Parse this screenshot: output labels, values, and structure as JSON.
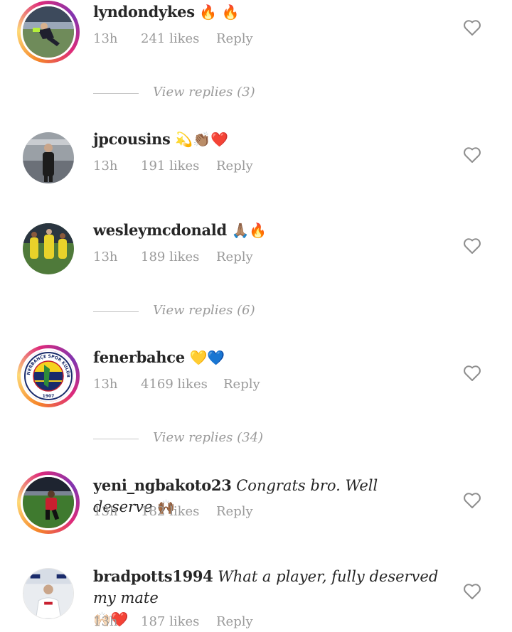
{
  "comments": [
    {
      "username": "lyndondykes",
      "text": "",
      "emoji": "🔥 🔥",
      "time": "13h",
      "likes": "241 likes",
      "reply": "Reply",
      "avatar": "football player photo",
      "ring": true,
      "replies": "View replies (3)"
    },
    {
      "username": "jpcousins",
      "text": "",
      "emoji": "💫👏🏽❤️",
      "time": "13h",
      "likes": "191 likes",
      "reply": "Reply",
      "avatar": "man standing in stadium photo",
      "ring": false,
      "replies": ""
    },
    {
      "username": "wesleymcdonald",
      "text": "",
      "emoji": "🙏🏽🔥",
      "time": "13h",
      "likes": "189 likes",
      "reply": "Reply",
      "avatar": "players in yellow kits photo",
      "ring": false,
      "replies": "View replies (6)"
    },
    {
      "username": "fenerbahce",
      "text": "",
      "emoji": "💛💙",
      "time": "13h",
      "likes": "4169 likes",
      "reply": "Reply",
      "avatar": "Fenerbahçe Spor Kulübü crest",
      "ring": true,
      "replies": "View replies (34)"
    },
    {
      "username": "yeni_ngbakoto23",
      "text": "Congrats bro. Well deserve",
      "emoji": "🙌🏾",
      "time": "13h",
      "likes": "182 likes",
      "reply": "Reply",
      "avatar": "football player on pitch photo",
      "ring": true,
      "replies": ""
    },
    {
      "username": "bradpotts1994",
      "text": "What a player, fully deserved my mate",
      "emoji": "🙌🏻❤️",
      "time": "13h",
      "likes": "187 likes",
      "reply": "Reply",
      "avatar": "man in white shirt photo",
      "ring": false,
      "replies": ""
    }
  ],
  "crest": {
    "top_text": "FENERBAHÇE SPOR KULÜBÜ",
    "year": "1907"
  },
  "colors": {
    "meta": "#9a9a9a",
    "ring_start": "#f58529",
    "ring_end": "#8134af",
    "navy": "#1a2b6b",
    "yellow": "#f6d21f"
  }
}
